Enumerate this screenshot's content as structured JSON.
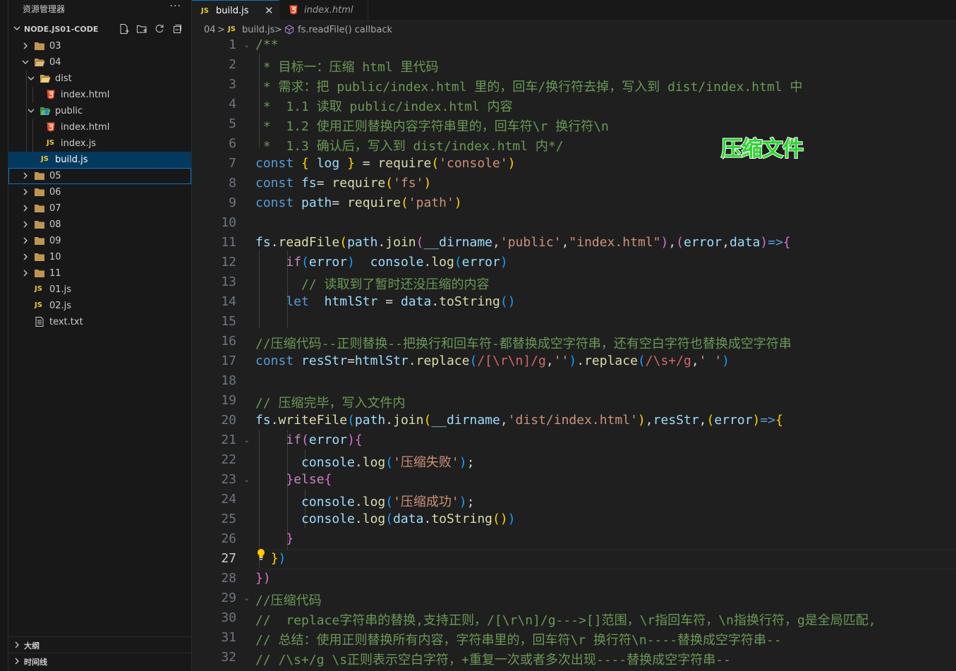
{
  "sidebar": {
    "title": "资源管理器",
    "more": "···",
    "workspace": "NODE.JS01-CODE",
    "tree": [
      {
        "label": "03"
      },
      {
        "label": "04"
      },
      {
        "label": "dist"
      },
      {
        "label": "index.html"
      },
      {
        "label": "public"
      },
      {
        "label": "index.html"
      },
      {
        "label": "index.js"
      },
      {
        "label": "build.js"
      },
      {
        "label": "05"
      },
      {
        "label": "06"
      },
      {
        "label": "07"
      },
      {
        "label": "08"
      },
      {
        "label": "09"
      },
      {
        "label": "10"
      },
      {
        "label": "11"
      },
      {
        "label": "01.js"
      },
      {
        "label": "02.js"
      },
      {
        "label": "text.txt"
      }
    ],
    "outline": "大纲",
    "timeline": "时间线",
    "js_badge": "JS"
  },
  "tabs": [
    {
      "badge": "JS",
      "label": "build.js",
      "close": "✕"
    },
    {
      "label": "index.html"
    }
  ],
  "breadcrumb": {
    "folder": "04",
    "sep": ">",
    "file": "build.js",
    "symbol": "fs.readFile() callback"
  },
  "overlay_text": "压缩文件",
  "editor": {
    "line_numbers": [
      "1",
      "2",
      "3",
      "4",
      "5",
      "6",
      "7",
      "8",
      "9",
      "10",
      "11",
      "12",
      "13",
      "14",
      "15",
      "16",
      "17",
      "18",
      "19",
      "20",
      "21",
      "22",
      "23",
      "24",
      "25",
      "26",
      "27",
      "28",
      "29",
      "30",
      "31",
      "32"
    ],
    "current_line": "27"
  },
  "colors": {
    "background": "#1f1f1f",
    "sidebar": "#181818",
    "selection": "#04395e",
    "accent": "#0078d4",
    "overlay": "#29d62c"
  }
}
